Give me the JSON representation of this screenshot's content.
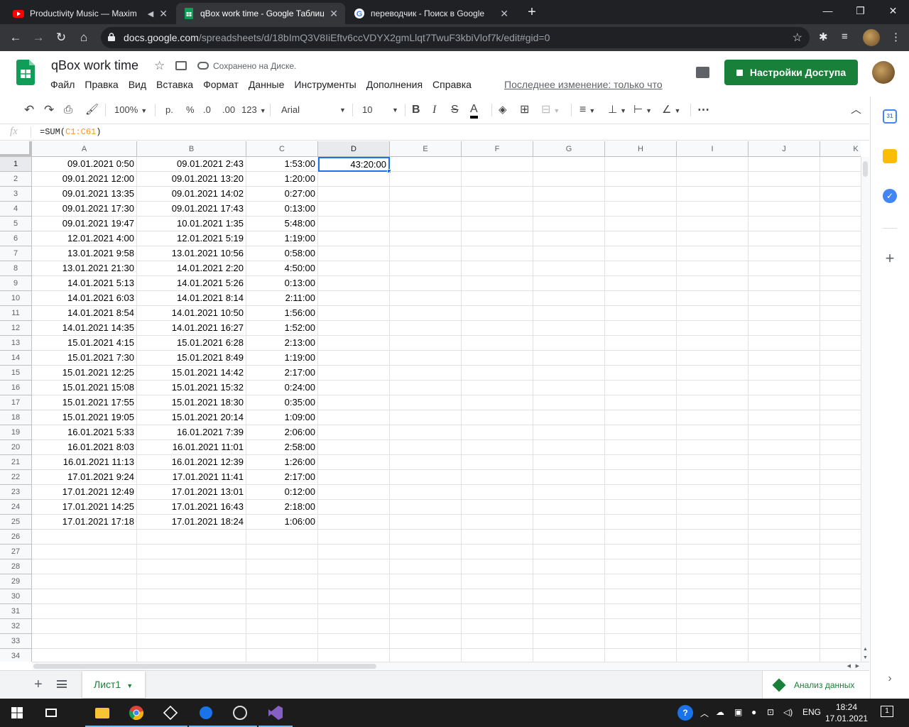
{
  "browser": {
    "tabs": [
      {
        "title": "Productivity Music — Maxim",
        "active": false
      },
      {
        "title": "qBox work time - Google Таблиц",
        "active": true
      },
      {
        "title": "переводчик - Поиск в Google",
        "active": false
      }
    ],
    "url_host": "docs.google.com",
    "url_path": "/spreadsheets/d/18bImQ3V8IiEftv6ccVDYX2gmLlqt7TwuF3kbiVlof7k/edit#gid=0"
  },
  "docs": {
    "title": "qBox work time",
    "saved_status": "Сохранено на Диске.",
    "menu": [
      "Файл",
      "Правка",
      "Вид",
      "Вставка",
      "Формат",
      "Данные",
      "Инструменты",
      "Дополнения",
      "Справка"
    ],
    "last_edit": "Последнее изменение: только что",
    "share_label": "Настройки Доступа"
  },
  "format_toolbar": {
    "zoom": "100%",
    "currency": "р.",
    "percent": "%",
    "dec_less": ".0",
    "dec_more": ".00",
    "number_format": "123",
    "font": "Arial",
    "font_size": "10",
    "bold": "B",
    "italic": "I",
    "strike": "S",
    "text_color": "A",
    "more": "⋯"
  },
  "formula_bar": {
    "fx": "fx",
    "prefix": "=SUM(",
    "range": "C1:C61",
    "suffix": ")"
  },
  "grid": {
    "columns": [
      "A",
      "B",
      "C",
      "D",
      "E",
      "F",
      "G",
      "H",
      "I",
      "J",
      "K"
    ],
    "selected_column": "D",
    "selected_row": 1,
    "active_cell": "D1",
    "active_value": "43:20:00",
    "rows": [
      [
        "09.01.2021 0:50",
        "09.01.2021 2:43",
        "1:53:00"
      ],
      [
        "09.01.2021 12:00",
        "09.01.2021 13:20",
        "1:20:00"
      ],
      [
        "09.01.2021 13:35",
        "09.01.2021 14:02",
        "0:27:00"
      ],
      [
        "09.01.2021 17:30",
        "09.01.2021 17:43",
        "0:13:00"
      ],
      [
        "09.01.2021 19:47",
        "10.01.2021 1:35",
        "5:48:00"
      ],
      [
        "12.01.2021 4:00",
        "12.01.2021 5:19",
        "1:19:00"
      ],
      [
        "13.01.2021 9:58",
        "13.01.2021 10:56",
        "0:58:00"
      ],
      [
        "13.01.2021 21:30",
        "14.01.2021 2:20",
        "4:50:00"
      ],
      [
        "14.01.2021 5:13",
        "14.01.2021 5:26",
        "0:13:00"
      ],
      [
        "14.01.2021 6:03",
        "14.01.2021 8:14",
        "2:11:00"
      ],
      [
        "14.01.2021 8:54",
        "14.01.2021 10:50",
        "1:56:00"
      ],
      [
        "14.01.2021 14:35",
        "14.01.2021 16:27",
        "1:52:00"
      ],
      [
        "15.01.2021 4:15",
        "15.01.2021 6:28",
        "2:13:00"
      ],
      [
        "15.01.2021 7:30",
        "15.01.2021 8:49",
        "1:19:00"
      ],
      [
        "15.01.2021 12:25",
        "15.01.2021 14:42",
        "2:17:00"
      ],
      [
        "15.01.2021 15:08",
        "15.01.2021 15:32",
        "0:24:00"
      ],
      [
        "15.01.2021 17:55",
        "15.01.2021 18:30",
        "0:35:00"
      ],
      [
        "15.01.2021 19:05",
        "15.01.2021 20:14",
        "1:09:00"
      ],
      [
        "16.01.2021 5:33",
        "16.01.2021 7:39",
        "2:06:00"
      ],
      [
        "16.01.2021 8:03",
        "16.01.2021 11:01",
        "2:58:00"
      ],
      [
        "16.01.2021 11:13",
        "16.01.2021 12:39",
        "1:26:00"
      ],
      [
        "17.01.2021 9:24",
        "17.01.2021 11:41",
        "2:17:00"
      ],
      [
        "17.01.2021 12:49",
        "17.01.2021 13:01",
        "0:12:00"
      ],
      [
        "17.01.2021 14:25",
        "17.01.2021 16:43",
        "2:18:00"
      ],
      [
        "17.01.2021 17:18",
        "17.01.2021 18:24",
        "1:06:00"
      ]
    ],
    "row_count": 34
  },
  "sheets": {
    "tabs": [
      "Лист1"
    ],
    "explore_label": "Анализ данных"
  },
  "taskbar": {
    "lang": "ENG",
    "time": "18:24",
    "date": "17.01.2021",
    "notification_count": "1"
  },
  "colors": {
    "accent_green": "#188038",
    "selection_blue": "#1a73e8",
    "formula_ref": "#f7981d"
  }
}
